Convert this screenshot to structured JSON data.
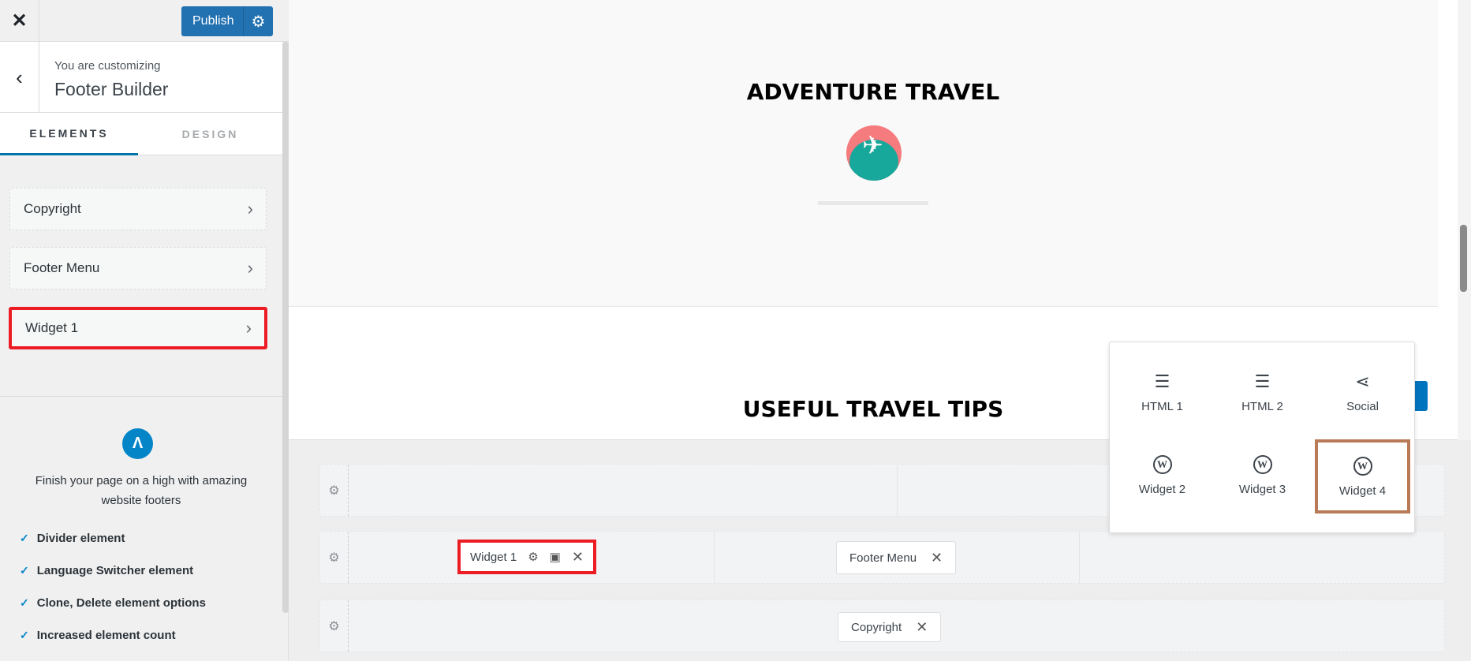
{
  "topbar": {
    "publish": "Publish"
  },
  "header": {
    "subtitle": "You are customizing",
    "title": "Footer Builder"
  },
  "tabs": [
    {
      "label": "ELEMENTS",
      "active": true
    },
    {
      "label": "DESIGN",
      "active": false
    }
  ],
  "elements": [
    {
      "label": "Copyright"
    },
    {
      "label": "Footer Menu"
    },
    {
      "label": "Widget 1",
      "highlighted": true
    }
  ],
  "promo": {
    "text": "Finish your page on a high with amazing website footers",
    "features": [
      "Divider element",
      "Language Switcher element",
      "Clone, Delete element options",
      "Increased element count"
    ]
  },
  "preview": {
    "heading1": "ADVENTURE TRAVEL",
    "heading2": "USEFUL TRAVEL TIPS"
  },
  "builder": {
    "widget1": "Widget 1",
    "footer_menu": "Footer Menu",
    "copyright": "Copyright"
  },
  "popup": {
    "items": [
      {
        "label": "HTML 1",
        "icon": "text-lines-icon"
      },
      {
        "label": "HTML 2",
        "icon": "text-lines-icon"
      },
      {
        "label": "Social",
        "icon": "share-icon"
      },
      {
        "label": "Widget 2",
        "icon": "wordpress-icon"
      },
      {
        "label": "Widget 3",
        "icon": "wordpress-icon"
      },
      {
        "label": "Widget 4",
        "icon": "wordpress-icon",
        "highlighted": true
      }
    ]
  },
  "colors": {
    "accent": "#2271b1",
    "highlight_red": "#ec1c24",
    "highlight_brown": "#b97a57"
  }
}
